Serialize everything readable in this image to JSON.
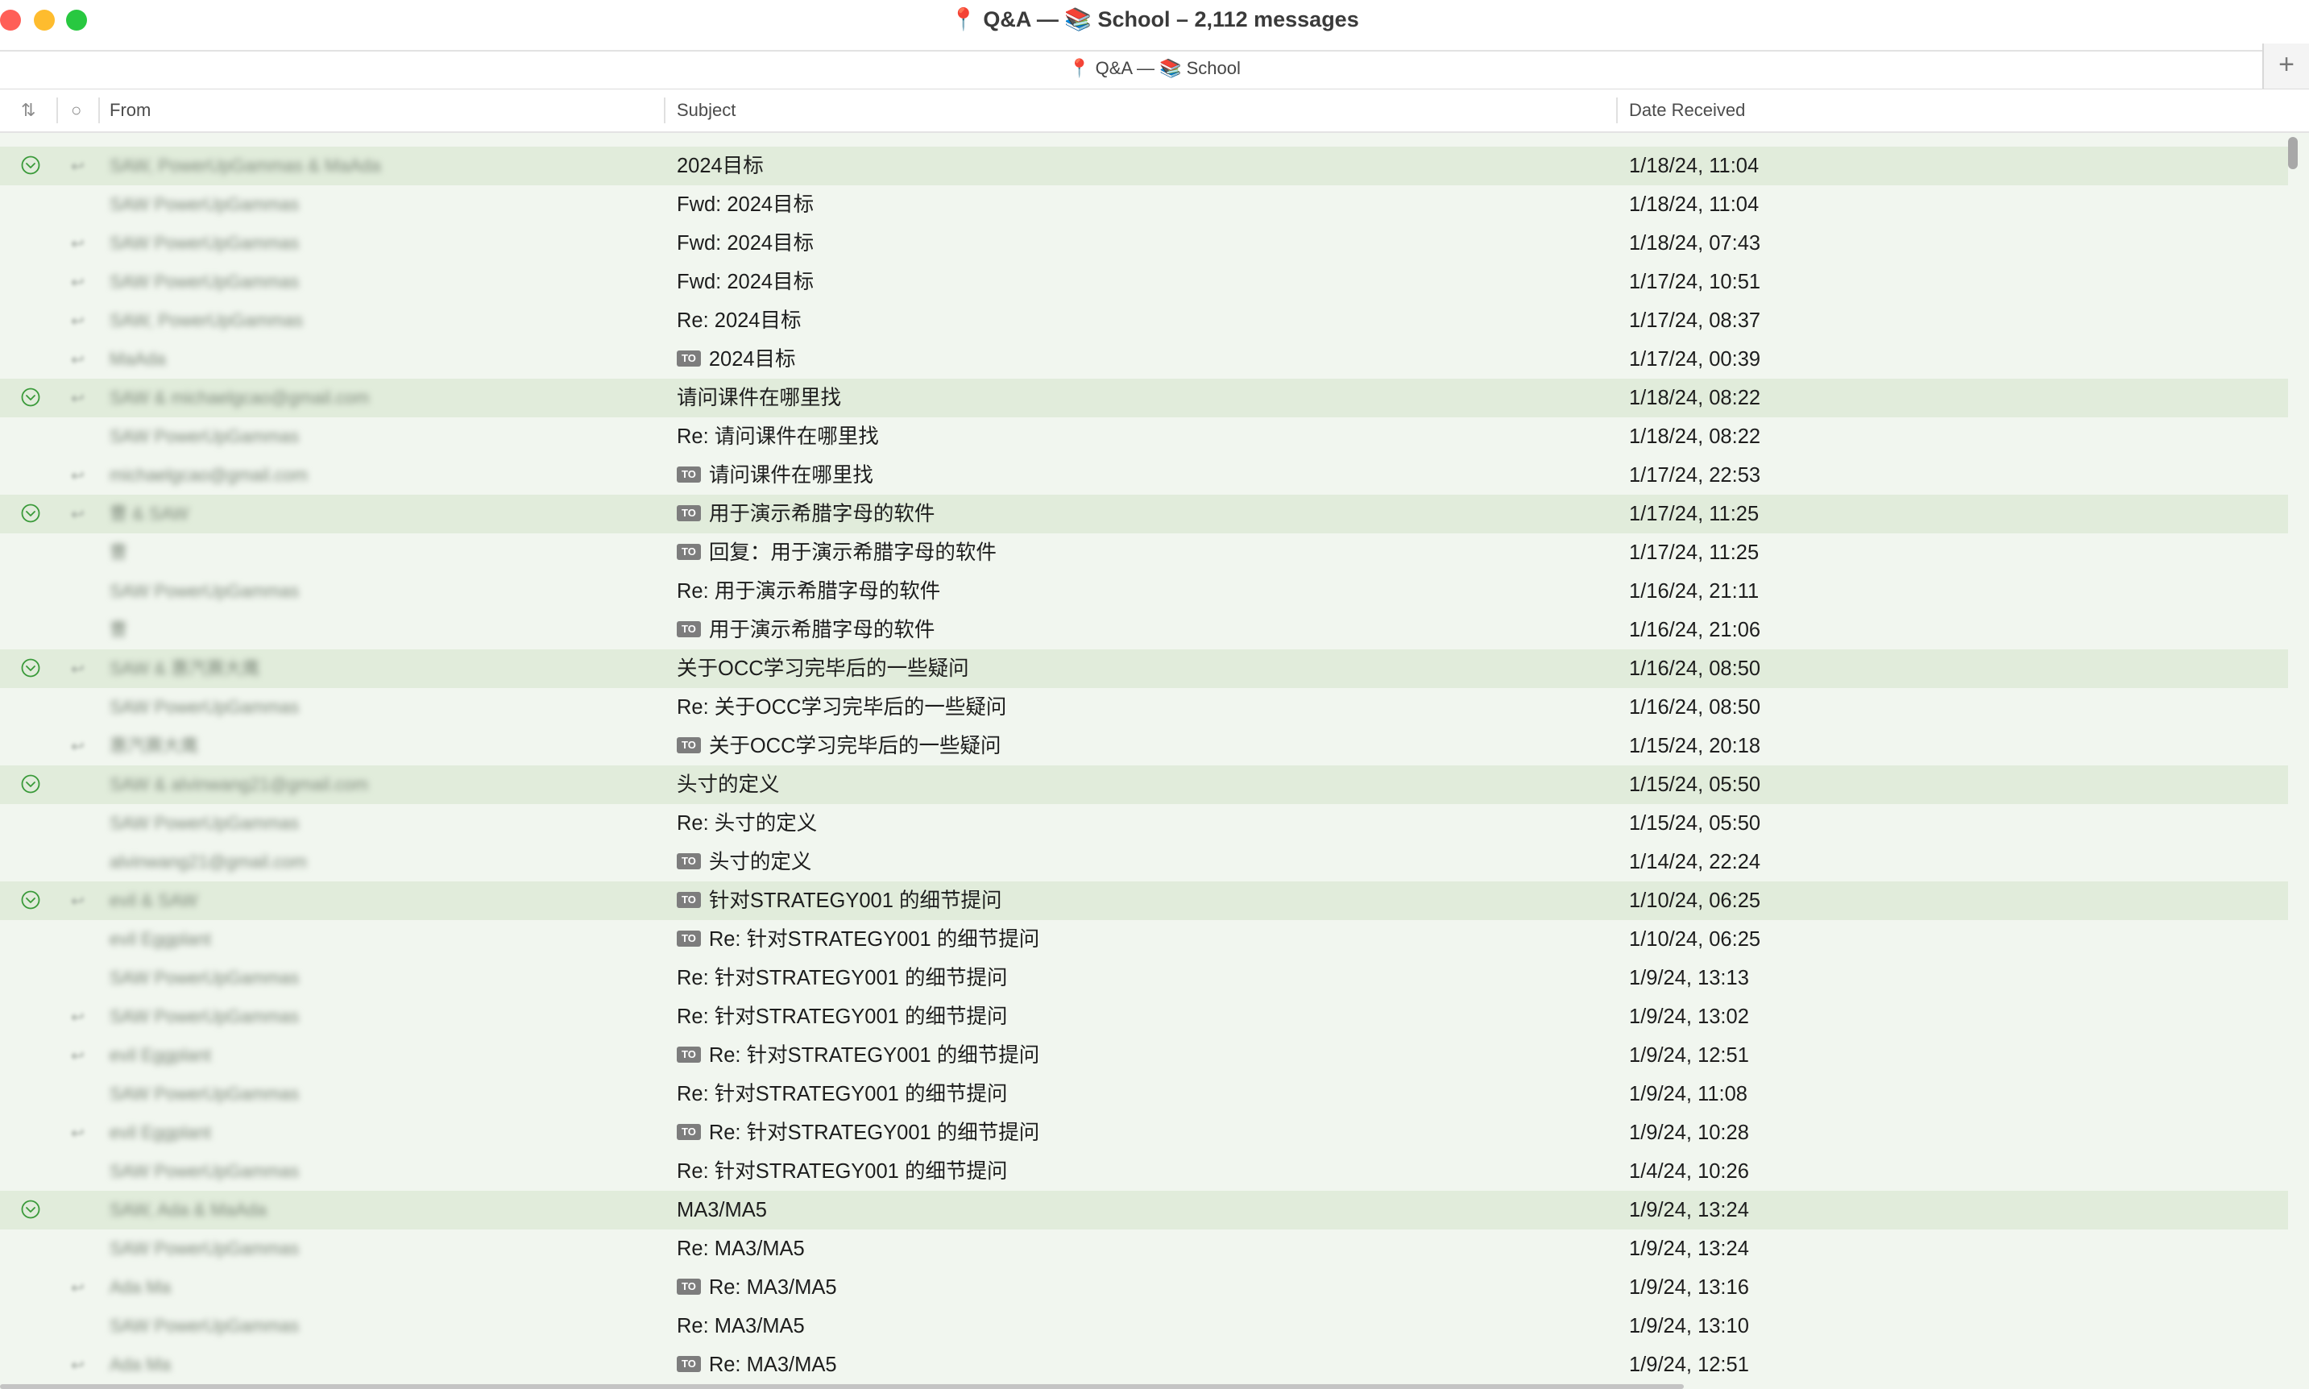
{
  "window": {
    "title": "📍 Q&A — 📚 School – 2,112 messages",
    "tab_label": "📍 Q&A — 📚 School",
    "add_tab_icon": "plus-icon",
    "traffic_lights": [
      "#ff5f57",
      "#febc2e",
      "#28c840"
    ]
  },
  "columns": {
    "sort_icon": "⇅",
    "status_icon": "○",
    "from": "From",
    "subject": "Subject",
    "date": "Date Received"
  },
  "colors": {
    "thread_row": "#e1ecdb",
    "chevron": "#3a9a3a",
    "to_badge": "#7d7d7d"
  },
  "rows": [
    {
      "thread": true,
      "reply": true,
      "from": "SAW, PowerUpGammas & MaAda",
      "to": false,
      "subject": "2024目标",
      "date": "1/18/24, 11:04"
    },
    {
      "thread": false,
      "reply": false,
      "from": "SAW PowerUpGammas",
      "to": false,
      "subject": "Fwd: 2024目标",
      "date": "1/18/24, 11:04"
    },
    {
      "thread": false,
      "reply": true,
      "from": "SAW PowerUpGammas",
      "to": false,
      "subject": "Fwd: 2024目标",
      "date": "1/18/24, 07:43"
    },
    {
      "thread": false,
      "reply": true,
      "from": "SAW PowerUpGammas",
      "to": false,
      "subject": "Fwd: 2024目标",
      "date": "1/17/24, 10:51"
    },
    {
      "thread": false,
      "reply": true,
      "from": "SAW, PowerUpGammas",
      "to": false,
      "subject": "Re: 2024目标",
      "date": "1/17/24, 08:37"
    },
    {
      "thread": false,
      "reply": true,
      "from": "MaAda",
      "to": true,
      "subject": "2024目标",
      "date": "1/17/24, 00:39"
    },
    {
      "thread": true,
      "reply": true,
      "from": "SAW & michaelgcao@gmail.com",
      "to": false,
      "subject": "请问课件在哪里找",
      "date": "1/18/24, 08:22"
    },
    {
      "thread": false,
      "reply": false,
      "from": "SAW PowerUpGammas",
      "to": false,
      "subject": "Re: 请问课件在哪里找",
      "date": "1/18/24, 08:22"
    },
    {
      "thread": false,
      "reply": true,
      "from": "michaelgcao@gmail.com",
      "to": true,
      "subject": "请问课件在哪里找",
      "date": "1/17/24, 22:53"
    },
    {
      "thread": true,
      "reply": true,
      "from": "曹 & SAW",
      "to": true,
      "subject": "用于演示希腊字母的软件",
      "date": "1/17/24, 11:25"
    },
    {
      "thread": false,
      "reply": false,
      "from": "曹",
      "to": true,
      "subject": "回复：用于演示希腊字母的软件",
      "date": "1/17/24, 11:25"
    },
    {
      "thread": false,
      "reply": false,
      "from": "SAW PowerUpGammas",
      "to": false,
      "subject": "Re: 用于演示希腊字母的软件",
      "date": "1/16/24, 21:11"
    },
    {
      "thread": false,
      "reply": false,
      "from": "曹",
      "to": true,
      "subject": "用于演示希腊字母的软件",
      "date": "1/16/24, 21:06"
    },
    {
      "thread": true,
      "reply": true,
      "from": "SAW & 惠汽赛大鹰",
      "to": false,
      "subject": "关于OCC学习完毕后的一些疑问",
      "date": "1/16/24, 08:50"
    },
    {
      "thread": false,
      "reply": false,
      "from": "SAW PowerUpGammas",
      "to": false,
      "subject": "Re: 关于OCC学习完毕后的一些疑问",
      "date": "1/16/24, 08:50"
    },
    {
      "thread": false,
      "reply": true,
      "from": "惠汽赛大鹰",
      "to": true,
      "subject": "关于OCC学习完毕后的一些疑问",
      "date": "1/15/24, 20:18"
    },
    {
      "thread": true,
      "reply": false,
      "from": "SAW & alvinwang21@gmail.com",
      "to": false,
      "subject": "头寸的定义",
      "date": "1/15/24, 05:50"
    },
    {
      "thread": false,
      "reply": false,
      "from": "SAW PowerUpGammas",
      "to": false,
      "subject": "Re: 头寸的定义",
      "date": "1/15/24, 05:50"
    },
    {
      "thread": false,
      "reply": false,
      "from": "alvinwang21@gmail.com",
      "to": true,
      "subject": "头寸的定义",
      "date": "1/14/24, 22:24"
    },
    {
      "thread": true,
      "reply": true,
      "from": "evil & SAW",
      "to": true,
      "subject": "针对STRATEGY001 的细节提问",
      "date": "1/10/24, 06:25"
    },
    {
      "thread": false,
      "reply": false,
      "from": "evil Eggplant",
      "to": true,
      "subject": "Re: 针对STRATEGY001 的细节提问",
      "date": "1/10/24, 06:25"
    },
    {
      "thread": false,
      "reply": false,
      "from": "SAW PowerUpGammas",
      "to": false,
      "subject": "Re: 针对STRATEGY001 的细节提问",
      "date": "1/9/24, 13:13"
    },
    {
      "thread": false,
      "reply": true,
      "from": "SAW PowerUpGammas",
      "to": false,
      "subject": "Re: 针对STRATEGY001 的细节提问",
      "date": "1/9/24, 13:02"
    },
    {
      "thread": false,
      "reply": true,
      "from": "evil Eggplant",
      "to": true,
      "subject": "Re: 针对STRATEGY001 的细节提问",
      "date": "1/9/24, 12:51"
    },
    {
      "thread": false,
      "reply": false,
      "from": "SAW PowerUpGammas",
      "to": false,
      "subject": "Re: 针对STRATEGY001 的细节提问",
      "date": "1/9/24, 11:08"
    },
    {
      "thread": false,
      "reply": true,
      "from": "evil Eggplant",
      "to": true,
      "subject": "Re: 针对STRATEGY001 的细节提问",
      "date": "1/9/24, 10:28"
    },
    {
      "thread": false,
      "reply": false,
      "from": "SAW PowerUpGammas",
      "to": false,
      "subject": "Re: 针对STRATEGY001 的细节提问",
      "date": "1/4/24, 10:26"
    },
    {
      "thread": true,
      "reply": false,
      "from": "SAW, Ada & MaAda",
      "to": false,
      "subject": "MA3/MA5",
      "date": "1/9/24, 13:24"
    },
    {
      "thread": false,
      "reply": false,
      "from": "SAW PowerUpGammas",
      "to": false,
      "subject": "Re: MA3/MA5",
      "date": "1/9/24, 13:24"
    },
    {
      "thread": false,
      "reply": true,
      "from": "Ada Ma",
      "to": true,
      "subject": "Re: MA3/MA5",
      "date": "1/9/24, 13:16"
    },
    {
      "thread": false,
      "reply": false,
      "from": "SAW PowerUpGammas",
      "to": false,
      "subject": "Re: MA3/MA5",
      "date": "1/9/24, 13:10"
    },
    {
      "thread": false,
      "reply": true,
      "from": "Ada Ma",
      "to": true,
      "subject": "Re: MA3/MA5",
      "date": "1/9/24, 12:51"
    }
  ]
}
